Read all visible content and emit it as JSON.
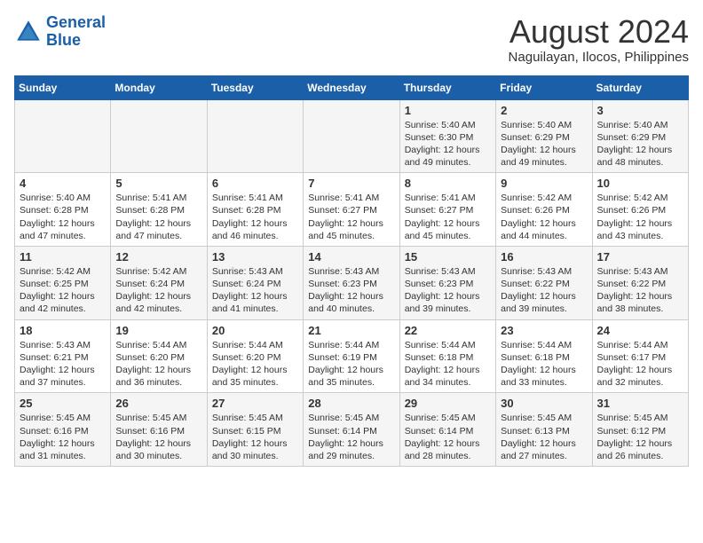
{
  "logo": {
    "line1": "General",
    "line2": "Blue"
  },
  "title": "August 2024",
  "subtitle": "Naguilayan, Ilocos, Philippines",
  "days_of_week": [
    "Sunday",
    "Monday",
    "Tuesday",
    "Wednesday",
    "Thursday",
    "Friday",
    "Saturday"
  ],
  "weeks": [
    [
      {
        "day": "",
        "content": ""
      },
      {
        "day": "",
        "content": ""
      },
      {
        "day": "",
        "content": ""
      },
      {
        "day": "",
        "content": ""
      },
      {
        "day": "1",
        "content": "Sunrise: 5:40 AM\nSunset: 6:30 PM\nDaylight: 12 hours\nand 49 minutes."
      },
      {
        "day": "2",
        "content": "Sunrise: 5:40 AM\nSunset: 6:29 PM\nDaylight: 12 hours\nand 49 minutes."
      },
      {
        "day": "3",
        "content": "Sunrise: 5:40 AM\nSunset: 6:29 PM\nDaylight: 12 hours\nand 48 minutes."
      }
    ],
    [
      {
        "day": "4",
        "content": "Sunrise: 5:40 AM\nSunset: 6:28 PM\nDaylight: 12 hours\nand 47 minutes."
      },
      {
        "day": "5",
        "content": "Sunrise: 5:41 AM\nSunset: 6:28 PM\nDaylight: 12 hours\nand 47 minutes."
      },
      {
        "day": "6",
        "content": "Sunrise: 5:41 AM\nSunset: 6:28 PM\nDaylight: 12 hours\nand 46 minutes."
      },
      {
        "day": "7",
        "content": "Sunrise: 5:41 AM\nSunset: 6:27 PM\nDaylight: 12 hours\nand 45 minutes."
      },
      {
        "day": "8",
        "content": "Sunrise: 5:41 AM\nSunset: 6:27 PM\nDaylight: 12 hours\nand 45 minutes."
      },
      {
        "day": "9",
        "content": "Sunrise: 5:42 AM\nSunset: 6:26 PM\nDaylight: 12 hours\nand 44 minutes."
      },
      {
        "day": "10",
        "content": "Sunrise: 5:42 AM\nSunset: 6:26 PM\nDaylight: 12 hours\nand 43 minutes."
      }
    ],
    [
      {
        "day": "11",
        "content": "Sunrise: 5:42 AM\nSunset: 6:25 PM\nDaylight: 12 hours\nand 42 minutes."
      },
      {
        "day": "12",
        "content": "Sunrise: 5:42 AM\nSunset: 6:24 PM\nDaylight: 12 hours\nand 42 minutes."
      },
      {
        "day": "13",
        "content": "Sunrise: 5:43 AM\nSunset: 6:24 PM\nDaylight: 12 hours\nand 41 minutes."
      },
      {
        "day": "14",
        "content": "Sunrise: 5:43 AM\nSunset: 6:23 PM\nDaylight: 12 hours\nand 40 minutes."
      },
      {
        "day": "15",
        "content": "Sunrise: 5:43 AM\nSunset: 6:23 PM\nDaylight: 12 hours\nand 39 minutes."
      },
      {
        "day": "16",
        "content": "Sunrise: 5:43 AM\nSunset: 6:22 PM\nDaylight: 12 hours\nand 39 minutes."
      },
      {
        "day": "17",
        "content": "Sunrise: 5:43 AM\nSunset: 6:22 PM\nDaylight: 12 hours\nand 38 minutes."
      }
    ],
    [
      {
        "day": "18",
        "content": "Sunrise: 5:43 AM\nSunset: 6:21 PM\nDaylight: 12 hours\nand 37 minutes."
      },
      {
        "day": "19",
        "content": "Sunrise: 5:44 AM\nSunset: 6:20 PM\nDaylight: 12 hours\nand 36 minutes."
      },
      {
        "day": "20",
        "content": "Sunrise: 5:44 AM\nSunset: 6:20 PM\nDaylight: 12 hours\nand 35 minutes."
      },
      {
        "day": "21",
        "content": "Sunrise: 5:44 AM\nSunset: 6:19 PM\nDaylight: 12 hours\nand 35 minutes."
      },
      {
        "day": "22",
        "content": "Sunrise: 5:44 AM\nSunset: 6:18 PM\nDaylight: 12 hours\nand 34 minutes."
      },
      {
        "day": "23",
        "content": "Sunrise: 5:44 AM\nSunset: 6:18 PM\nDaylight: 12 hours\nand 33 minutes."
      },
      {
        "day": "24",
        "content": "Sunrise: 5:44 AM\nSunset: 6:17 PM\nDaylight: 12 hours\nand 32 minutes."
      }
    ],
    [
      {
        "day": "25",
        "content": "Sunrise: 5:45 AM\nSunset: 6:16 PM\nDaylight: 12 hours\nand 31 minutes."
      },
      {
        "day": "26",
        "content": "Sunrise: 5:45 AM\nSunset: 6:16 PM\nDaylight: 12 hours\nand 30 minutes."
      },
      {
        "day": "27",
        "content": "Sunrise: 5:45 AM\nSunset: 6:15 PM\nDaylight: 12 hours\nand 30 minutes."
      },
      {
        "day": "28",
        "content": "Sunrise: 5:45 AM\nSunset: 6:14 PM\nDaylight: 12 hours\nand 29 minutes."
      },
      {
        "day": "29",
        "content": "Sunrise: 5:45 AM\nSunset: 6:14 PM\nDaylight: 12 hours\nand 28 minutes."
      },
      {
        "day": "30",
        "content": "Sunrise: 5:45 AM\nSunset: 6:13 PM\nDaylight: 12 hours\nand 27 minutes."
      },
      {
        "day": "31",
        "content": "Sunrise: 5:45 AM\nSunset: 6:12 PM\nDaylight: 12 hours\nand 26 minutes."
      }
    ]
  ]
}
